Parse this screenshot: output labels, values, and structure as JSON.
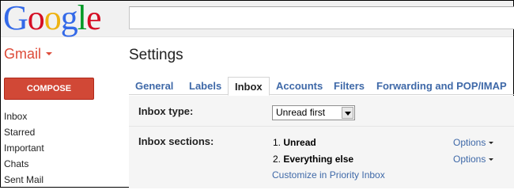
{
  "logo": {
    "text": "Google",
    "letters": [
      "G",
      "o",
      "o",
      "g",
      "l",
      "e"
    ],
    "colors": [
      "#3369e8",
      "#d50f25",
      "#eeb211",
      "#3369e8",
      "#009925",
      "#d50f25"
    ]
  },
  "search": {
    "value": ""
  },
  "app": {
    "name": "Gmail"
  },
  "page": {
    "title": "Settings"
  },
  "compose": {
    "label": "COMPOSE"
  },
  "nav": {
    "items": [
      "Inbox",
      "Starred",
      "Important",
      "Chats",
      "Sent Mail"
    ]
  },
  "tabs": [
    "General",
    "Labels",
    "Inbox",
    "Accounts",
    "Filters",
    "Forwarding and POP/IMAP"
  ],
  "active_tab": "Inbox",
  "inbox_type": {
    "label": "Inbox type:",
    "selected": "Unread first"
  },
  "inbox_sections": {
    "label": "Inbox sections:",
    "items": [
      {
        "number": "1.",
        "name": "Unread",
        "options": "Options"
      },
      {
        "number": "2.",
        "name": "Everything else",
        "options": "Options"
      }
    ],
    "link": "Customize in Priority Inbox"
  }
}
